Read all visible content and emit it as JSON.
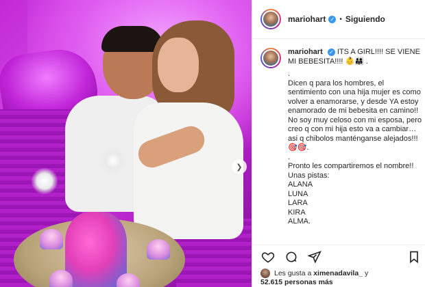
{
  "header": {
    "username": "mariohart",
    "separator": "•",
    "follow_label": "Siguiendo"
  },
  "caption": {
    "username": "mariohart",
    "first_line": "ITS A GIRL!!!! SE VIENE MI BEBESITA!!!! 👶👨‍👩‍👧 .",
    "body": ".\nDicen q para los hombres, el sentimiento con una hija mujer es como volver a enamorarse, y desde YA estoy enamorado de mi bebesita en camino!! No soy muy celoso con mi esposa, pero creo q con mi hija esto va a cambiar… asi q chibolos manténganse alejados!!! 🎯🎯.\n.\nPronto les compartiremos el nombre!!\nUnas pistas:\nALANA\nLUNA\nLARA\nKIRA\nALMA."
  },
  "likes": {
    "prefix": "Les gusta a",
    "liker": "ximenadavila_",
    "conjunction": "y",
    "count_text": "52.615 personas más"
  },
  "icons": {
    "verified": "verified-badge-icon",
    "like": "heart-icon",
    "comment": "comment-icon",
    "share": "send-icon",
    "save": "bookmark-icon",
    "next": "chevron-right-icon"
  },
  "colors": {
    "verified": "#3897f0",
    "text": "#262626",
    "border": "#efefef"
  }
}
